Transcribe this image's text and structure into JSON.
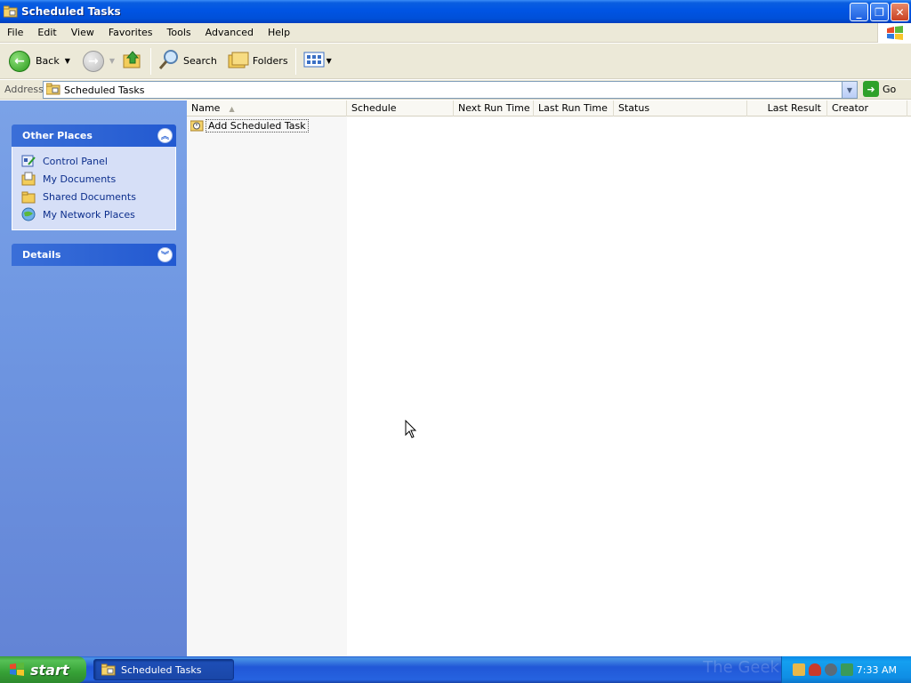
{
  "window": {
    "title": "Scheduled Tasks",
    "buttons": {
      "minimize": "minimize",
      "restore": "restore",
      "close": "close"
    }
  },
  "menu": [
    "File",
    "Edit",
    "View",
    "Favorites",
    "Tools",
    "Advanced",
    "Help"
  ],
  "toolbar": {
    "back_label": "Back",
    "search_label": "Search",
    "folders_label": "Folders"
  },
  "address": {
    "label": "Address",
    "value": "Scheduled Tasks",
    "go_label": "Go"
  },
  "taskpane": {
    "other_places": {
      "title": "Other Places",
      "items": [
        "Control Panel",
        "My Documents",
        "Shared Documents",
        "My Network Places"
      ]
    },
    "details": {
      "title": "Details"
    }
  },
  "list": {
    "columns": [
      "Name",
      "Schedule",
      "Next Run Time",
      "Last Run Time",
      "Status",
      "Last Result",
      "Creator"
    ],
    "items": [
      {
        "name": "Add Scheduled Task"
      }
    ]
  },
  "taskbar": {
    "start_label": "start",
    "window_button": "Scheduled Tasks",
    "clock": "7:33 AM",
    "watermark": "The Geek Stuff"
  },
  "colors": {
    "title_bar": "#0054e3",
    "task_pane": "#6f97e2",
    "start_green": "#36a136",
    "link_text": "#0c2e8c"
  }
}
